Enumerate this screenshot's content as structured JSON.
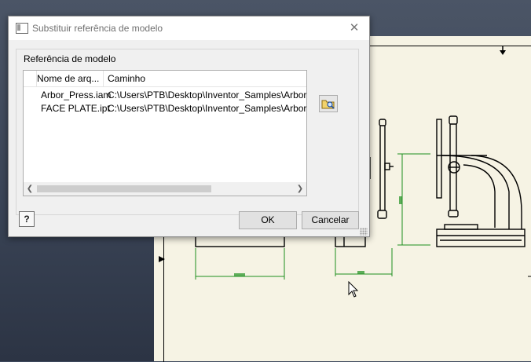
{
  "dialog": {
    "title": "Substituir referência de modelo",
    "group_label": "Referência de modelo",
    "columns": {
      "name": "Nome de arq...",
      "path": "Caminho"
    },
    "rows": [
      {
        "name": "Arbor_Press.iam",
        "path": "C:\\Users\\PTB\\Desktop\\Inventor_Samples\\Arbor Press"
      },
      {
        "name": "FACE PLATE.ipt",
        "path": "C:\\Users\\PTB\\Desktop\\Inventor_Samples\\Arbor Press"
      }
    ],
    "buttons": {
      "ok": "OK",
      "cancel": "Cancelar",
      "help": "?"
    },
    "icons": {
      "close": "close-icon",
      "browse": "folder-browse-icon",
      "scroll_left": "chevron-left-icon",
      "scroll_right": "chevron-right-icon"
    }
  },
  "colors": {
    "dimension_green": "#1e8f1e",
    "sheet": "#f6f3e4",
    "dialog_bg": "#f0f0f0"
  }
}
